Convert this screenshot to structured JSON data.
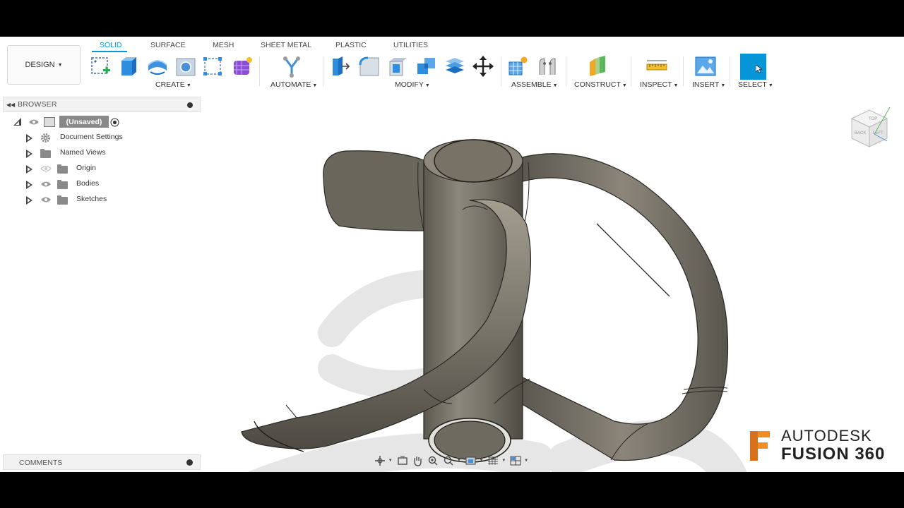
{
  "toolbar": {
    "workspace_label": "DESIGN",
    "tabs": [
      "SOLID",
      "SURFACE",
      "MESH",
      "SHEET METAL",
      "PLASTIC",
      "UTILITIES"
    ],
    "active_tab": "SOLID",
    "groups": [
      "CREATE",
      "AUTOMATE",
      "MODIFY",
      "ASSEMBLE",
      "CONSTRUCT",
      "INSPECT",
      "INSERT",
      "SELECT"
    ]
  },
  "browser": {
    "title": "BROWSER",
    "root_label": "(Unsaved)",
    "items": [
      "Document Settings",
      "Named Views",
      "Origin",
      "Bodies",
      "Sketches"
    ]
  },
  "comments": {
    "title": "COMMENTS"
  },
  "branding": {
    "line1": "AUTODESK",
    "line2": "FUSION 360"
  },
  "viewcube": {
    "faces": [
      "TOP",
      "BACK",
      "LEFT"
    ]
  },
  "colors": {
    "accent": "#0696d7",
    "logo_orange": "#f28d24",
    "model": "#7d776c"
  }
}
